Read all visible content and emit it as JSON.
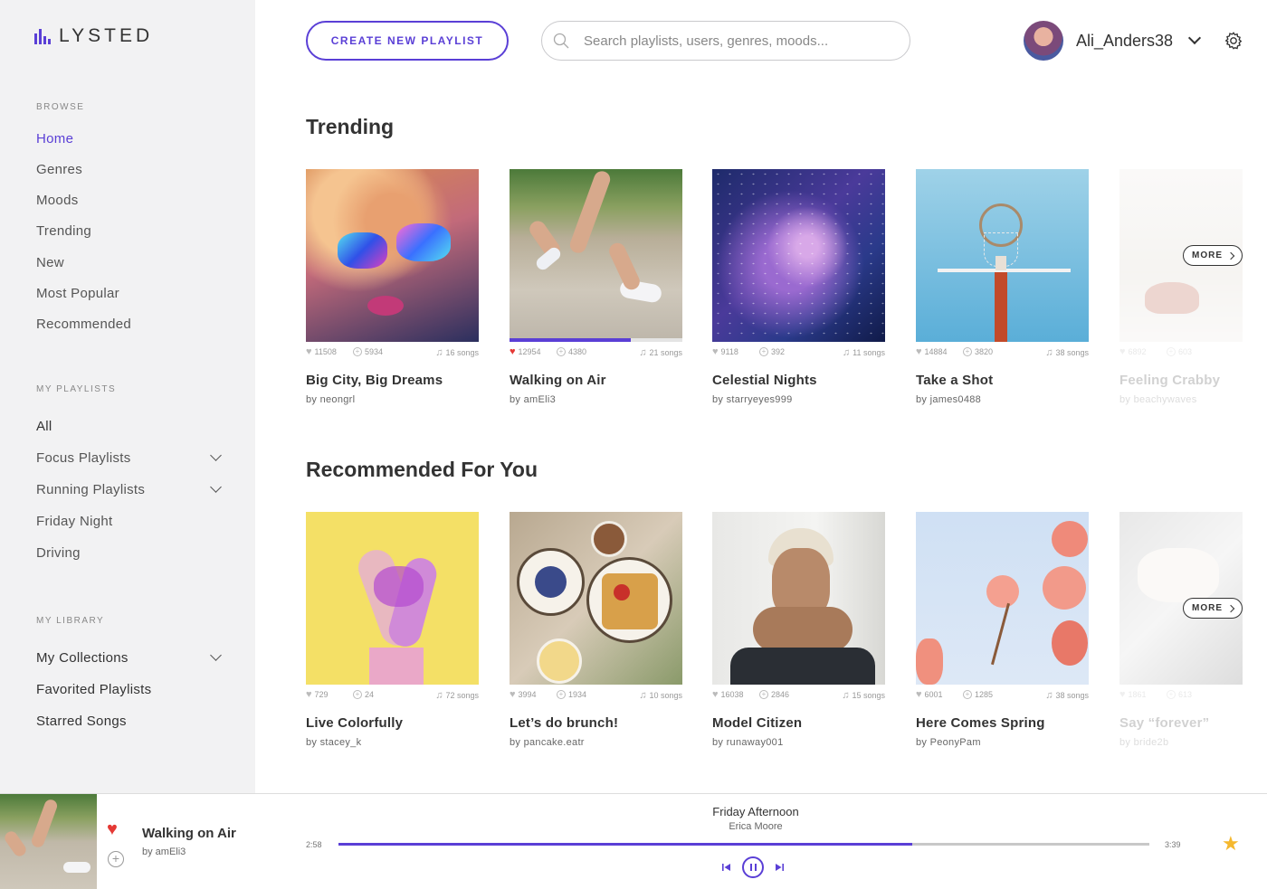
{
  "app": {
    "name": "LYSTED"
  },
  "sidebar": {
    "browse_head": "BROWSE",
    "browse": [
      "Home",
      "Genres",
      "Moods",
      "Trending",
      "New",
      "Most Popular",
      "Recommended"
    ],
    "playlists_head": "MY PLAYLISTS",
    "playlists": [
      "All",
      "Focus Playlists",
      "Running Playlists",
      "Friday Night",
      "Driving"
    ],
    "library_head": "MY LIBRARY",
    "library": [
      "My Collections",
      "Favorited Playlists",
      "Starred Songs"
    ]
  },
  "header": {
    "create_label": "CREATE NEW PLAYLIST",
    "search_placeholder": "Search playlists, users, genres, moods...",
    "username": "Ali_Anders38"
  },
  "sections": {
    "trending_title": "Trending",
    "recommended_title": "Recommended For You",
    "more_label": "MORE"
  },
  "trending": [
    {
      "likes": "11508",
      "adds": "5934",
      "songs": "16 songs",
      "title": "Big City, Big Dreams",
      "by": "by neongrl",
      "liked": false
    },
    {
      "likes": "12954",
      "adds": "4380",
      "songs": "21 songs",
      "title": "Walking on Air",
      "by": "by amEli3",
      "liked": true,
      "progress": 0.7
    },
    {
      "likes": "9118",
      "adds": "392",
      "songs": "11 songs",
      "title": "Celestial Nights",
      "by": "by starryeyes999",
      "liked": false
    },
    {
      "likes": "14884",
      "adds": "3820",
      "songs": "38 songs",
      "title": "Take a Shot",
      "by": "by james0488",
      "liked": false
    },
    {
      "likes": "6892",
      "adds": "603",
      "songs": "",
      "title": "Feeling Crabby",
      "by": "by beachywaves",
      "liked": false
    }
  ],
  "recommended": [
    {
      "likes": "729",
      "adds": "24",
      "songs": "72 songs",
      "title": "Live Colorfully",
      "by": "by stacey_k",
      "liked": false
    },
    {
      "likes": "3994",
      "adds": "1934",
      "songs": "10 songs",
      "title": "Let’s do brunch!",
      "by": "by pancake.eatr",
      "liked": false
    },
    {
      "likes": "16038",
      "adds": "2846",
      "songs": "15 songs",
      "title": "Model Citizen",
      "by": "by runaway001",
      "liked": false
    },
    {
      "likes": "6001",
      "adds": "1285",
      "songs": "38 songs",
      "title": "Here Comes Spring",
      "by": "by PeonyPam",
      "liked": false
    },
    {
      "likes": "1861",
      "adds": "613",
      "songs": "",
      "title": "Say “forever”",
      "by": "by bride2b",
      "liked": false
    }
  ],
  "player": {
    "playlist_title": "Walking on Air",
    "playlist_by": "by amEli3",
    "song_title": "Friday Afternoon",
    "song_artist": "Erica Moore",
    "time_elapsed": "2:58",
    "time_total": "3:39",
    "progress": 0.708
  },
  "colors": {
    "accent": "#5a3fd6",
    "like": "#e53935",
    "star": "#f5b82e",
    "sidebar_bg": "#f2f2f3"
  }
}
